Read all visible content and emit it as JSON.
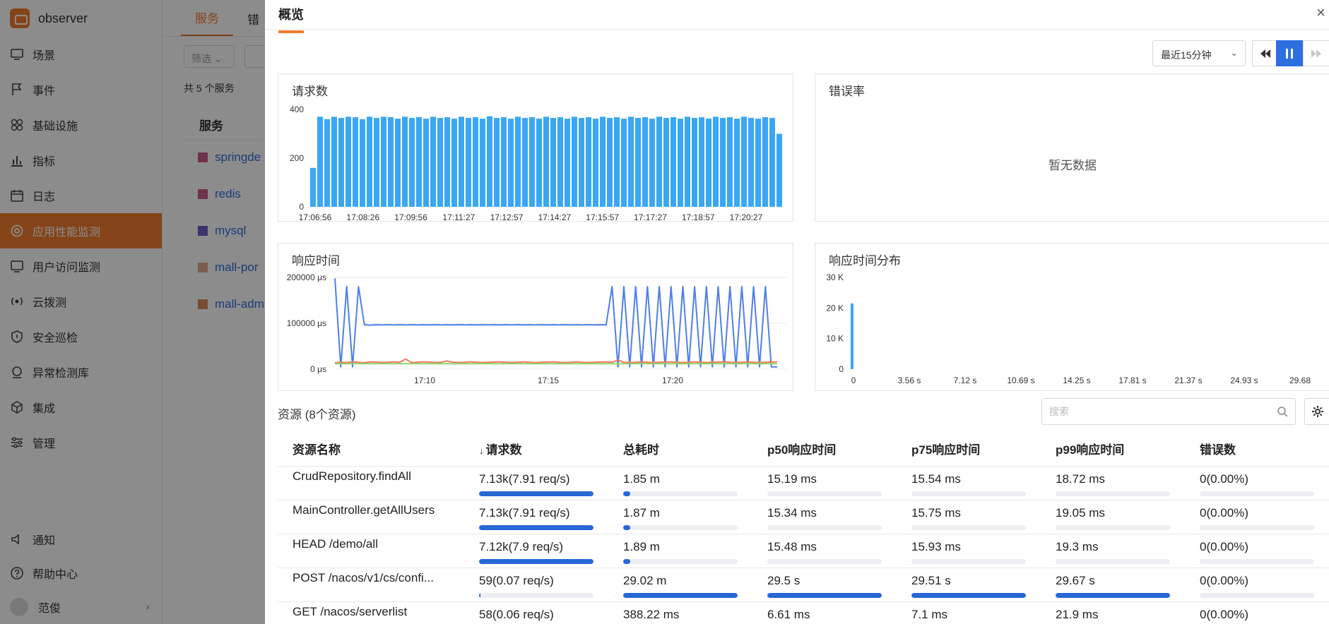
{
  "app": {
    "title": "observer"
  },
  "sidebar": {
    "items": [
      {
        "label": "场景",
        "icon": "monitor-icon"
      },
      {
        "label": "事件",
        "icon": "flag-icon"
      },
      {
        "label": "基础设施",
        "icon": "grid-icon"
      },
      {
        "label": "指标",
        "icon": "bar-chart-icon"
      },
      {
        "label": "日志",
        "icon": "calendar-icon"
      },
      {
        "label": "应用性能监测",
        "icon": "target-icon",
        "active": true
      },
      {
        "label": "用户访问监测",
        "icon": "screen-icon"
      },
      {
        "label": "云拨测",
        "icon": "radio-icon"
      },
      {
        "label": "安全巡检",
        "icon": "shield-icon"
      },
      {
        "label": "异常检测库",
        "icon": "detect-icon"
      },
      {
        "label": "集成",
        "icon": "cube-icon"
      },
      {
        "label": "管理",
        "icon": "sliders-icon"
      }
    ],
    "bottom": [
      {
        "label": "通知",
        "icon": "speaker-icon"
      },
      {
        "label": "帮助中心",
        "icon": "help-icon"
      },
      {
        "label": "范俊",
        "icon": "avatar"
      }
    ]
  },
  "background": {
    "tabs": [
      "服务",
      "错"
    ],
    "filter_label": "筛选",
    "count_text": "共 5 个服务",
    "table_header": "服务",
    "services": [
      {
        "name": "springde",
        "color": "#c95c8a"
      },
      {
        "name": "redis",
        "color": "#c95c8a"
      },
      {
        "name": "mysql",
        "color": "#6d5fc9"
      },
      {
        "name": "mall-por",
        "color": "#e0a98a"
      },
      {
        "name": "mall-adm",
        "color": "#d98c5a"
      }
    ]
  },
  "drawer": {
    "tab_title": "概览",
    "time_range": "最近15分钟",
    "panels": {
      "requests_title": "请求数",
      "error_rate_title": "错误率",
      "error_rate_nodata": "暂无数据",
      "latency_title": "响应时间",
      "distribution_title": "响应时间分布"
    },
    "resources_title": "资源 (8个资源)",
    "search_placeholder": "搜索",
    "columns": [
      "资源名称",
      "请求数",
      "总耗时",
      "p50响应时间",
      "p75响应时间",
      "p99响应时间",
      "错误数"
    ],
    "rows": [
      {
        "name": "CrudRepository.findAll",
        "requests": "7.13k(7.91 req/s)",
        "requests_pct": 100,
        "total": "1.85 m",
        "total_pct": 6,
        "p50": "15.19 ms",
        "p50_pct": 0,
        "p75": "15.54 ms",
        "p75_pct": 0,
        "p99": "18.72 ms",
        "p99_pct": 0,
        "errors": "0(0.00%)",
        "errors_pct": 0
      },
      {
        "name": "MainController.getAllUsers",
        "requests": "7.13k(7.91 req/s)",
        "requests_pct": 100,
        "total": "1.87 m",
        "total_pct": 6,
        "p50": "15.34 ms",
        "p50_pct": 0,
        "p75": "15.75 ms",
        "p75_pct": 0,
        "p99": "19.05 ms",
        "p99_pct": 0,
        "errors": "0(0.00%)",
        "errors_pct": 0
      },
      {
        "name": "HEAD /demo/all",
        "requests": "7.12k(7.9 req/s)",
        "requests_pct": 100,
        "total": "1.89 m",
        "total_pct": 6,
        "p50": "15.48 ms",
        "p50_pct": 0,
        "p75": "15.93 ms",
        "p75_pct": 0,
        "p99": "19.3 ms",
        "p99_pct": 0,
        "errors": "0(0.00%)",
        "errors_pct": 0
      },
      {
        "name": "POST /nacos/v1/cs/confi...",
        "requests": "59(0.07 req/s)",
        "requests_pct": 1,
        "total": "29.02 m",
        "total_pct": 100,
        "p50": "29.5 s",
        "p50_pct": 100,
        "p75": "29.51 s",
        "p75_pct": 100,
        "p99": "29.67 s",
        "p99_pct": 100,
        "errors": "0(0.00%)",
        "errors_pct": 0
      },
      {
        "name": "GET /nacos/serverlist",
        "requests": "58(0.06 req/s)",
        "requests_pct": 1,
        "total": "388.22 ms",
        "total_pct": 0,
        "p50": "6.61 ms",
        "p50_pct": 0,
        "p75": "7.1 ms",
        "p75_pct": 0,
        "p99": "21.9 ms",
        "p99_pct": 0,
        "errors": "0(0.00%)",
        "errors_pct": 0
      }
    ]
  },
  "chart_data": [
    {
      "type": "bar",
      "title": "请求数",
      "ylim": [
        0,
        400
      ],
      "yticks": [
        "400",
        "200",
        "0"
      ],
      "xticks": [
        "17:06:56",
        "17:08:26",
        "17:09:56",
        "17:11:27",
        "17:12:57",
        "17:14:27",
        "17:15:57",
        "17:17:27",
        "17:18:57",
        "17:20:27"
      ],
      "values": [
        160,
        370,
        360,
        370,
        365,
        370,
        368,
        360,
        370,
        365,
        370,
        368,
        362,
        370,
        365,
        368,
        362,
        370,
        365,
        368,
        362,
        370,
        365,
        368,
        362,
        372,
        365,
        368,
        362,
        370,
        365,
        368,
        362,
        370,
        365,
        368,
        362,
        370,
        365,
        368,
        362,
        370,
        365,
        368,
        362,
        370,
        365,
        368,
        362,
        370,
        365,
        368,
        362,
        370,
        365,
        368,
        362,
        370,
        365,
        368,
        362,
        370,
        365,
        362,
        368,
        365,
        300
      ],
      "color": "#3aa7f5"
    },
    {
      "type": "line",
      "title": "响应时间",
      "ylim": [
        0,
        200000
      ],
      "yticks": [
        "200000 μs",
        "100000 μs",
        "0 μs"
      ],
      "xticks": [
        "17:10",
        "17:15",
        "17:20"
      ],
      "series": [
        {
          "color": "#4f7fe8",
          "values": [
            198000,
            5000,
            180000,
            5000,
            180000,
            97000,
            96000,
            97000,
            96500,
            97000,
            96500,
            97000,
            96500,
            97000,
            96500,
            97000,
            96500,
            97000,
            96500,
            97000,
            96500,
            97000,
            96500,
            97000,
            96500,
            97000,
            96500,
            97000,
            96500,
            97000,
            96500,
            97000,
            96500,
            97000,
            96500,
            97000,
            96500,
            97000,
            96500,
            97000,
            96500,
            97000,
            96500,
            97000,
            96500,
            97000,
            96500,
            180000,
            5000,
            180000,
            5000,
            180000,
            5000,
            180000,
            5000,
            180000,
            5000,
            180000,
            5000,
            180000,
            5000,
            180000,
            5000,
            180000,
            5000,
            180000,
            5000,
            180000,
            5000,
            180000,
            5000,
            180000,
            5000,
            180000,
            5000,
            5000
          ]
        },
        {
          "color": "#f07a5a",
          "values": [
            14000,
            15000,
            14500,
            16000,
            15000,
            14000,
            16000,
            15500,
            14500,
            15000,
            16000,
            15000,
            22000,
            14500,
            15000,
            16000,
            15500,
            14500,
            15000,
            18000,
            15000,
            14500,
            15000,
            16000,
            15000,
            14500,
            15000,
            15500,
            16000,
            15000,
            14500,
            15000,
            16000,
            15000,
            14500,
            15000,
            15500,
            16000,
            15000,
            14500,
            15000,
            16000,
            15000,
            14500,
            15000,
            15500,
            16000,
            15000,
            20000,
            15000,
            14500,
            15000,
            16000,
            15000,
            14500,
            15000,
            15500,
            16000,
            15000,
            14500,
            15000,
            16000,
            15000,
            14500,
            15000,
            15500,
            16000,
            15000,
            14500,
            15000,
            16000,
            15000,
            14500,
            15000,
            15500,
            16000
          ]
        },
        {
          "color": "#8bd46a",
          "values": [
            12000,
            12000,
            12000,
            12000,
            12000,
            12000,
            12000,
            12000,
            12000,
            12000,
            12000,
            12000,
            12000,
            12000,
            12000,
            12000,
            12000,
            12000,
            12000,
            12000,
            12000,
            12000,
            12000,
            12000,
            12000,
            12000,
            12000,
            12000,
            12000,
            12000,
            12000,
            12000,
            12000,
            12000,
            12000,
            12000,
            12000,
            12000,
            12000,
            12000,
            12000,
            12000,
            12000,
            12000,
            12000,
            12000,
            12000,
            12000,
            12000,
            12000,
            12000,
            12000,
            12000,
            12000,
            12000,
            12000,
            12000,
            12000,
            12000,
            12000,
            12000,
            12000,
            12000,
            12000,
            12000,
            12000,
            12000,
            12000,
            12000,
            12000,
            12000,
            12000,
            12000,
            12000,
            12000,
            12000
          ]
        }
      ]
    },
    {
      "type": "bar",
      "title": "响应时间分布",
      "ylim": [
        0,
        30000
      ],
      "yticks": [
        "30 K",
        "20 K",
        "10 K",
        "0"
      ],
      "xticks": [
        "0",
        "3.56 s",
        "7.12 s",
        "10.69 s",
        "14.25 s",
        "17.81 s",
        "21.37 s",
        "24.93 s",
        "29.68"
      ],
      "values": [
        21500
      ],
      "color": "#3aa7f5"
    }
  ]
}
